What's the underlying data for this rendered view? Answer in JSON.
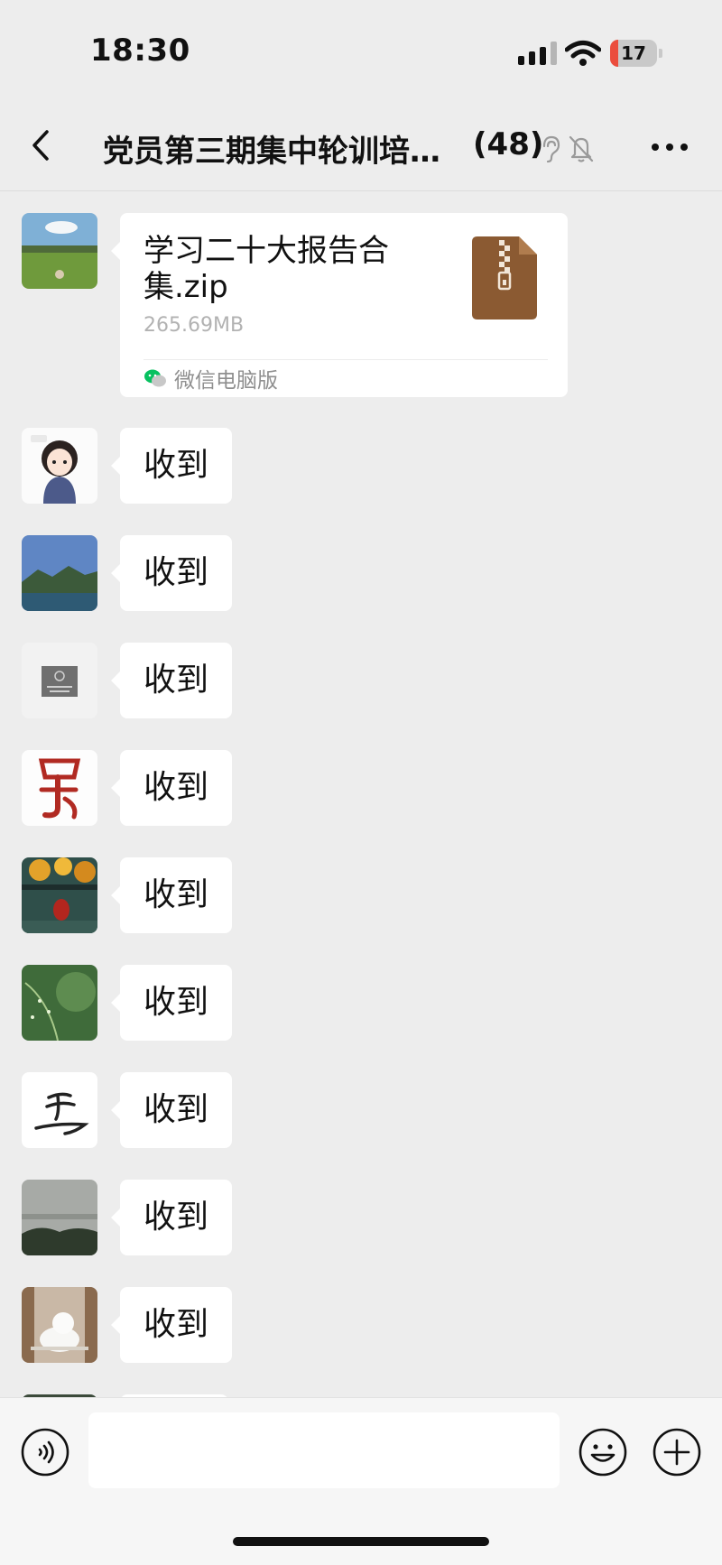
{
  "status_bar": {
    "time": "18:30",
    "battery_level": "17",
    "signal_bars": 3,
    "battery_color": "#eb4d3d"
  },
  "nav": {
    "back_icon": "chevron-left-icon",
    "title": "党员第三期集中轮训培…",
    "member_count": "(48)",
    "ear_icon": "ear-icon",
    "mute_icon": "bell-slash-icon",
    "more_icon": "more-icon"
  },
  "messages": [
    {
      "type": "file",
      "avatar_icon": "landscape-avatar",
      "file_name": "学习二十大报告合集.zip",
      "file_size": "265.69MB",
      "source": "微信电脑版",
      "file_icon": "zip-file-icon",
      "file_icon_color": "#8b5a32"
    },
    {
      "type": "text",
      "text": "收到",
      "avatar_icon": "cartoon-girl-avatar"
    },
    {
      "type": "text",
      "text": "收到",
      "avatar_icon": "mountain-lake-avatar"
    },
    {
      "type": "text",
      "text": "收到",
      "avatar_icon": "placeholder-avatar"
    },
    {
      "type": "text",
      "text": "收到",
      "avatar_icon": "red-seal-avatar"
    },
    {
      "type": "text",
      "text": "收到",
      "avatar_icon": "autumn-lantern-avatar"
    },
    {
      "type": "text",
      "text": "收到",
      "avatar_icon": "green-plant-avatar"
    },
    {
      "type": "text",
      "text": "收到",
      "avatar_icon": "calligraphy-avatar"
    },
    {
      "type": "text",
      "text": "收到",
      "avatar_icon": "foggy-landscape-avatar"
    },
    {
      "type": "text",
      "text": "收到",
      "avatar_icon": "white-cat-avatar"
    }
  ],
  "input_bar": {
    "voice_icon": "voice-icon",
    "placeholder": "",
    "emoji_icon": "emoji-icon",
    "plus_icon": "plus-circle-icon"
  },
  "colors": {
    "background": "#ededed",
    "bubble": "#ffffff",
    "accent_green": "#07c160"
  }
}
